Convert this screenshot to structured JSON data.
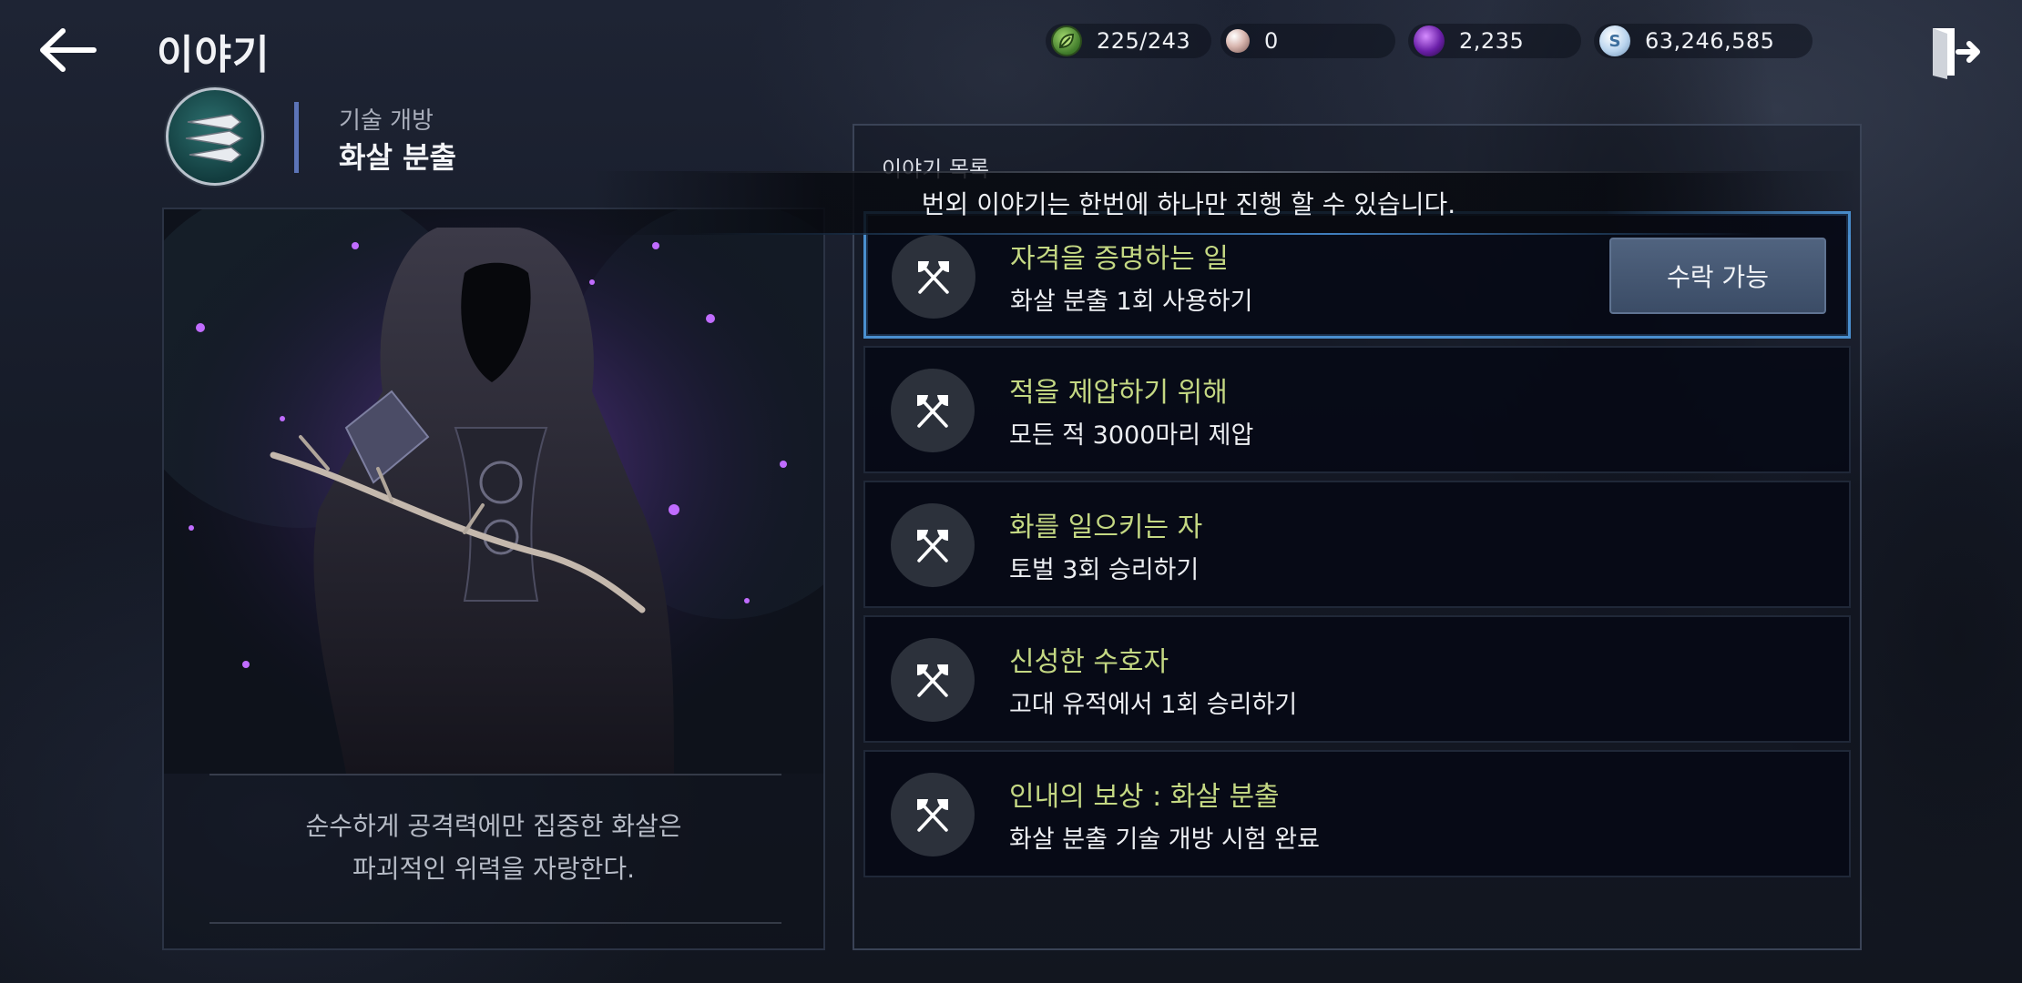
{
  "header": {
    "title": "이야기",
    "back_icon": "arrow-left-icon",
    "exit_icon": "exit-door-icon"
  },
  "currencies": [
    {
      "icon": "leaf-icon",
      "value": "225/243"
    },
    {
      "icon": "pearl-icon",
      "value": "0"
    },
    {
      "icon": "purple-orb-icon",
      "value": "2,235"
    },
    {
      "icon": "silver-coin-icon",
      "symbol": "S",
      "value": "63,246,585"
    }
  ],
  "skill": {
    "category": "기술 개방",
    "name": "화살 분출",
    "description_line1": "순수하게 공격력에만 집중한 화살은",
    "description_line2": "파괴적인 위력을 자랑한다."
  },
  "list": {
    "title": "이야기 목록",
    "notice": "번외 이야기는 한번에 하나만 진행 할 수 있습니다."
  },
  "quests": [
    {
      "title": "자격을 증명하는 일",
      "desc": "화살 분출 1회 사용하기",
      "selected": true,
      "action": "수락 가능"
    },
    {
      "title": "적을 제압하기 위해",
      "desc": "모든 적 3000마리 제압"
    },
    {
      "title": "화를 일으키는 자",
      "desc": "토벌 3회 승리하기"
    },
    {
      "title": "신성한 수호자",
      "desc": "고대 유적에서 1회 승리하기"
    },
    {
      "title": "인내의 보상 : 화살 분출",
      "desc": "화살 분출 기술 개방 시험 완료"
    }
  ],
  "colors": {
    "quest_title": "#c4d883",
    "selected_border": "#4a8fcf",
    "skill_divider": "#5c74b8"
  }
}
